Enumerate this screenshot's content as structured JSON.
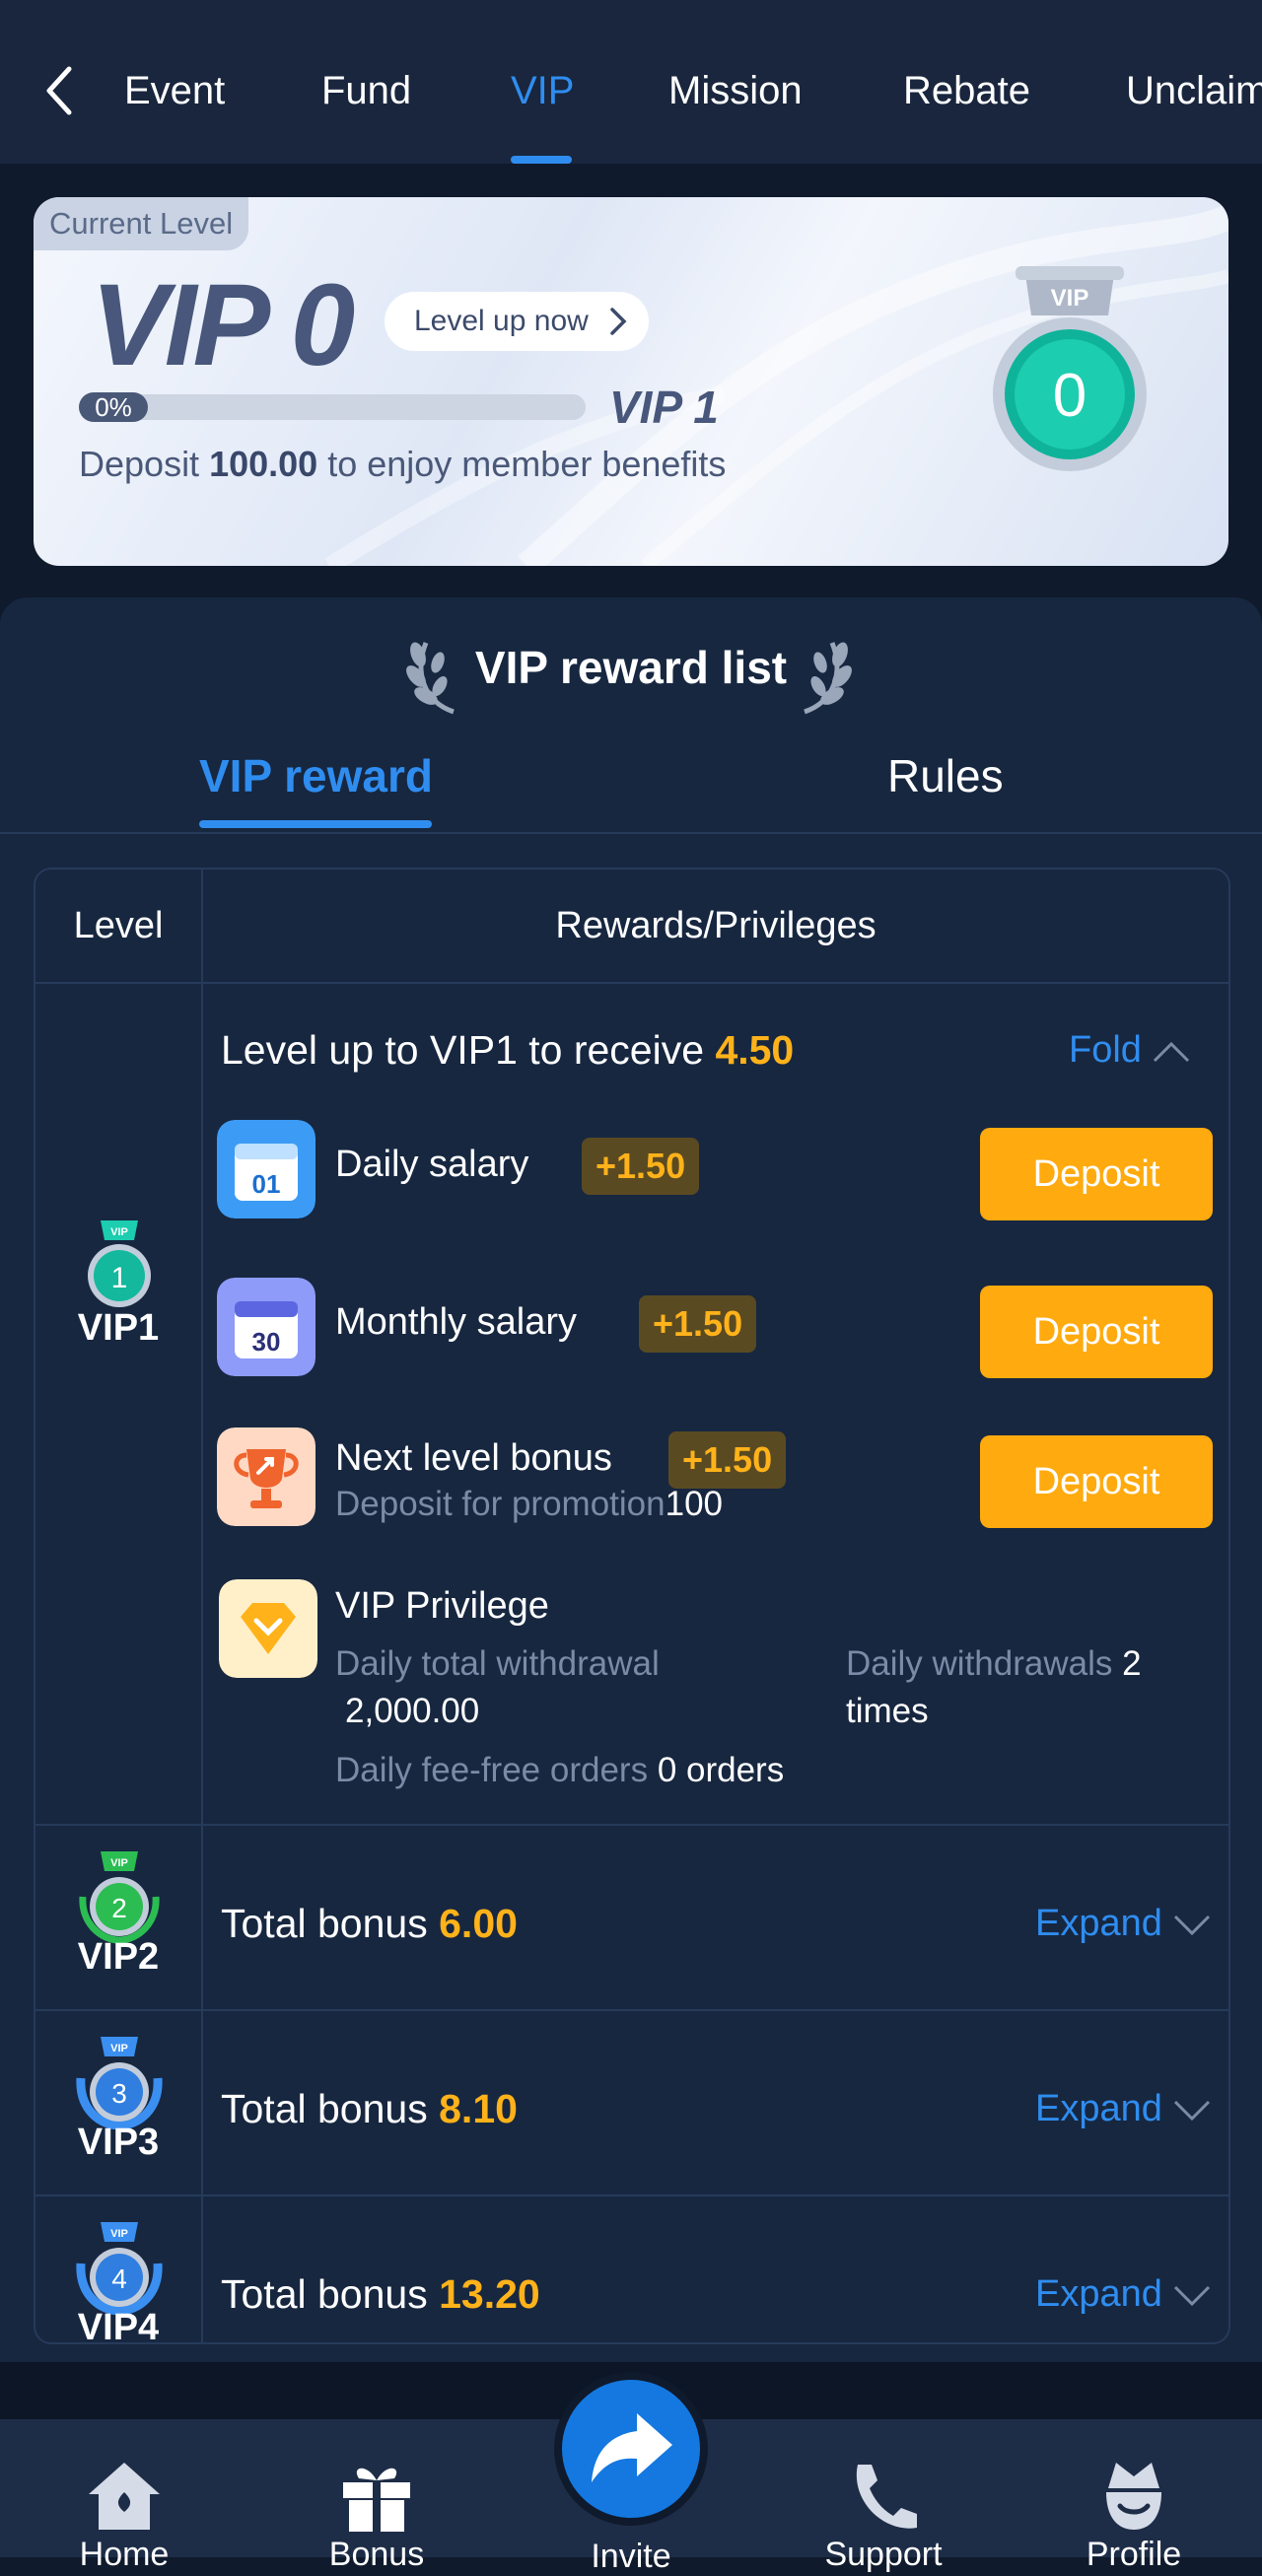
{
  "top_tabs": [
    {
      "label": "Event",
      "active": false
    },
    {
      "label": "Fund",
      "active": false
    },
    {
      "label": "VIP",
      "active": true
    },
    {
      "label": "Mission",
      "active": false
    },
    {
      "label": "Rebate",
      "active": false
    },
    {
      "label": "Unclaim",
      "active": false
    }
  ],
  "level_card": {
    "tag": "Current Level",
    "current_vip": "VIP 0",
    "level_up_label": "Level up now",
    "progress_label": "0%",
    "progress_fraction": 0,
    "next_vip": "VIP 1",
    "deposit_prefix": "Deposit",
    "deposit_amount": "100.00",
    "deposit_suffix": "to enjoy member benefits",
    "medal_number": "0",
    "medal_tag": "VIP"
  },
  "rewards": {
    "title": "VIP reward list",
    "tabs": {
      "vip_reward": "VIP reward",
      "rules": "Rules"
    },
    "header": {
      "level": "Level",
      "rewards": "Rewards/Privileges"
    },
    "vip1": {
      "name": "VIP1",
      "medal_number": "1",
      "title_prefix": "Level up to VIP1 to receive",
      "title_amount": "4.50",
      "toggle": "Fold",
      "items": [
        {
          "icon": "calendar-day-icon",
          "icon_text": "01",
          "label": "Daily salary",
          "bonus": "+1.50",
          "button": "Deposit"
        },
        {
          "icon": "calendar-month-icon",
          "icon_text": "30",
          "label": "Monthly salary",
          "bonus": "+1.50",
          "button": "Deposit"
        },
        {
          "icon": "trophy-icon",
          "label": "Next level bonus",
          "bonus": "+1.50",
          "button": "Deposit",
          "sub_label": "Deposit for promotion",
          "sub_value": "100"
        }
      ],
      "privilege": {
        "icon": "diamond-icon",
        "label": "VIP Privilege",
        "withdrawal_label": "Daily total withdrawal",
        "withdrawal_value": "2,000.00",
        "withdrawals_label": "Daily withdrawals",
        "withdrawals_value": "2",
        "withdrawals_unit": "times",
        "fee_free_label": "Daily fee-free orders",
        "fee_free_value": "0 orders"
      }
    },
    "collapsed_rows": [
      {
        "name": "VIP2",
        "medal_number": "2",
        "prefix": "Total bonus",
        "amount": "6.00",
        "toggle": "Expand"
      },
      {
        "name": "VIP3",
        "medal_number": "3",
        "prefix": "Total bonus",
        "amount": "8.10",
        "toggle": "Expand"
      },
      {
        "name": "VIP4",
        "medal_number": "4",
        "prefix": "Total bonus",
        "amount": "13.20",
        "toggle": "Expand"
      }
    ]
  },
  "bottom_nav": [
    {
      "label": "Home",
      "icon": "home-icon"
    },
    {
      "label": "Bonus",
      "icon": "gift-icon"
    },
    {
      "label": "Invite",
      "icon": "share-arrow-icon"
    },
    {
      "label": "Support",
      "icon": "phone-icon"
    },
    {
      "label": "Profile",
      "icon": "profile-icon"
    }
  ]
}
